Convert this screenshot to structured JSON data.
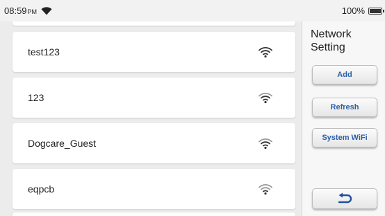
{
  "status_bar": {
    "time": "08:59",
    "ampm": "PM",
    "battery": "100%",
    "battery_level": 1.0,
    "icons": [
      "wifi-icon",
      "battery-icon"
    ]
  },
  "networks": [
    {
      "name": "test123",
      "icon": "wifi-signal-icon"
    },
    {
      "name": "123",
      "icon": "wifi-signal-icon"
    },
    {
      "name": "Dogcare_Guest",
      "icon": "wifi-signal-icon"
    },
    {
      "name": "eqpcb",
      "icon": "wifi-signal-icon"
    }
  ],
  "panel": {
    "title": "Network Setting",
    "buttons": {
      "add": "Add",
      "refresh": "Refresh",
      "system_wifi": "System WiFi"
    },
    "back_icon": "return-arrow-icon"
  },
  "colors": {
    "accent_text": "#2a5ea8",
    "background": "#ededed",
    "row_background": "#ffffff"
  }
}
